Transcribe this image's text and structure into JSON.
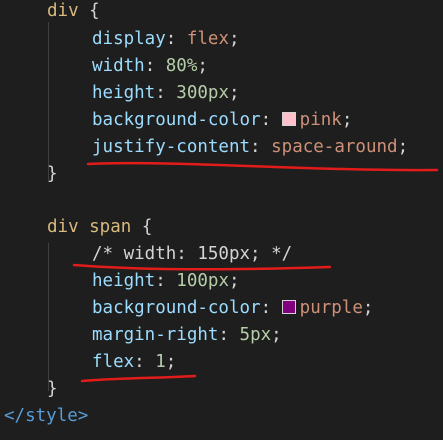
{
  "code": {
    "div_selector": "div",
    "brace_open": " {",
    "prop_display": "display",
    "val_display": "flex",
    "prop_width": "width",
    "val_width_num": "80",
    "val_width_unit": "%",
    "prop_height": "height",
    "val_height_num": "300",
    "val_height_unit": "px",
    "prop_bg": "background-color",
    "val_bg": "pink",
    "prop_justify": "justify-content",
    "val_justify": "space-around",
    "brace_close": "}",
    "span_selector": "div span",
    "comment": "/* width: 150px; */",
    "prop_height2": "height",
    "val_height2_num": "100",
    "val_height2_unit": "px",
    "prop_bg2": "background-color",
    "val_bg2": "purple",
    "prop_margin": "margin-right",
    "val_margin_num": "5",
    "val_margin_unit": "px",
    "prop_flex": "flex",
    "val_flex": "1",
    "style_close": "</style>"
  },
  "colors": {
    "pink": "#ffc0cb",
    "purple": "#800080",
    "underline": "#e21b1b"
  }
}
